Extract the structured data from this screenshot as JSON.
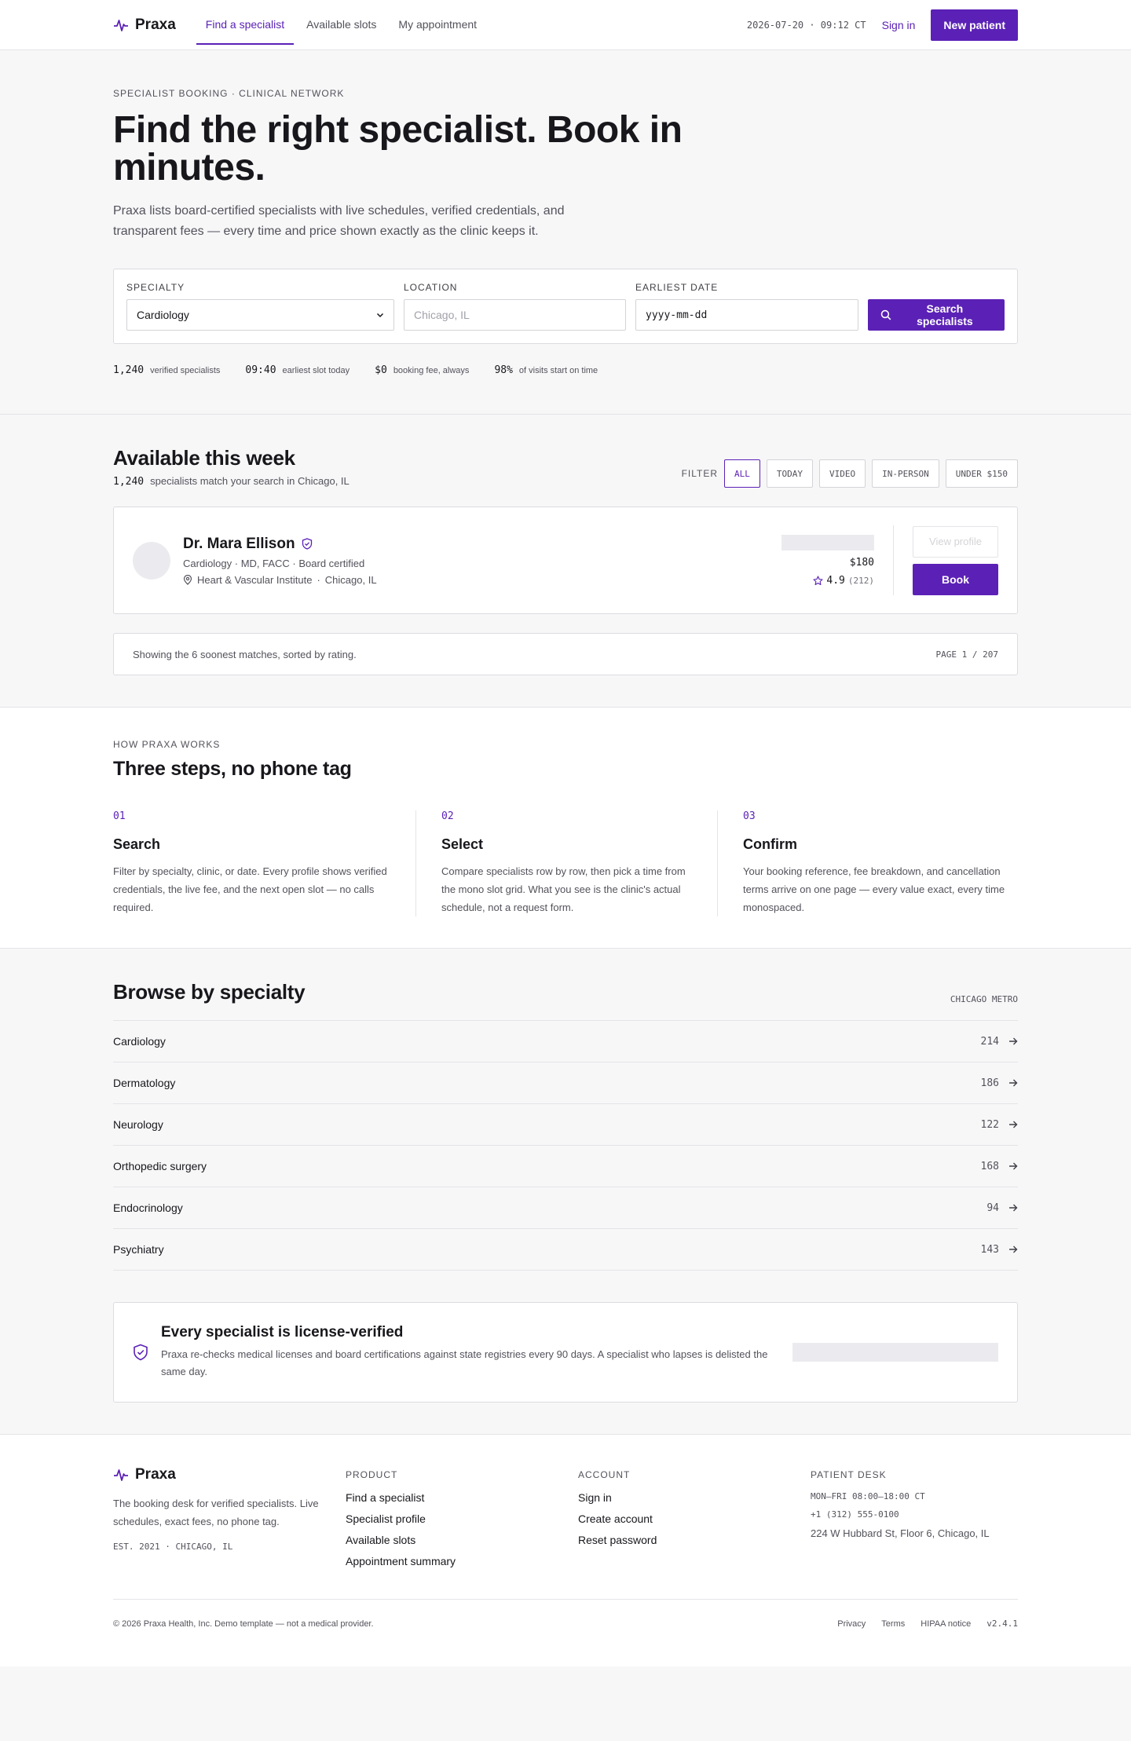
{
  "header": {
    "brand": "Praxa",
    "nav": [
      "Find a specialist",
      "Available slots",
      "My appointment"
    ],
    "timestamp": "2026-07-20 · 09:12 CT",
    "signin": "Sign in",
    "cta": "New patient"
  },
  "hero": {
    "eyebrow": "SPECIALIST BOOKING · CLINICAL NETWORK",
    "title": "Find the right specialist. Book in minutes.",
    "lede": "Praxa lists board-certified specialists with live schedules, verified credentials, and transparent fees — every time and price shown exactly as the clinic keeps it.",
    "search": {
      "specialty_label": "SPECIALTY",
      "specialty_value": "Cardiology",
      "location_label": "LOCATION",
      "location_placeholder": "Chicago, IL",
      "date_label": "EARLIEST DATE",
      "date_placeholder": "yyyy-mm-dd",
      "button": "Search specialists"
    },
    "stats": [
      {
        "value": "1,240",
        "label": "verified specialists"
      },
      {
        "value": "09:40",
        "label": "earliest slot today"
      },
      {
        "value": "$0",
        "label": "booking fee, always"
      },
      {
        "value": "98%",
        "label": "of visits start on time"
      }
    ]
  },
  "available": {
    "title": "Available this week",
    "count": "1,240",
    "count_label": "specialists match your search in Chicago, IL",
    "filter_label": "FILTER",
    "filters": [
      "ALL",
      "TODAY",
      "VIDEO",
      "IN-PERSON",
      "UNDER $150"
    ],
    "doctor": {
      "name": "Dr. Mara Ellison",
      "meta": "Cardiology · MD, FACC · Board certified",
      "clinic": "Heart & Vascular Institute",
      "city": "Chicago, IL",
      "price": "$180",
      "rating": "4.9",
      "reviews": "(212)",
      "view": "View profile",
      "book": "Book"
    },
    "pager_text": "Showing the 6 soonest matches, sorted by rating.",
    "pager_page": "PAGE 1 / 207"
  },
  "how": {
    "eyebrow": "HOW PRAXA WORKS",
    "title": "Three steps, no phone tag",
    "steps": [
      {
        "num": "01",
        "title": "Search",
        "text": "Filter by specialty, clinic, or date. Every profile shows verified credentials, the live fee, and the next open slot — no calls required."
      },
      {
        "num": "02",
        "title": "Select",
        "text": "Compare specialists row by row, then pick a time from the mono slot grid. What you see is the clinic's actual schedule, not a request form."
      },
      {
        "num": "03",
        "title": "Confirm",
        "text": "Your booking reference, fee breakdown, and cancellation terms arrive on one page — every value exact, every time monospaced."
      }
    ]
  },
  "browse": {
    "title": "Browse by specialty",
    "region": "CHICAGO METRO",
    "items": [
      {
        "name": "Cardiology",
        "count": "214"
      },
      {
        "name": "Dermatology",
        "count": "186"
      },
      {
        "name": "Neurology",
        "count": "122"
      },
      {
        "name": "Orthopedic surgery",
        "count": "168"
      },
      {
        "name": "Endocrinology",
        "count": "94"
      },
      {
        "name": "Psychiatry",
        "count": "143"
      }
    ],
    "verify_title": "Every specialist is license-verified",
    "verify_text": "Praxa re-checks medical licenses and board certifications against state registries every 90 days. A specialist who lapses is delisted the same day."
  },
  "footer": {
    "brand": "Praxa",
    "desc": "The booking desk for verified specialists. Live schedules, exact fees, no phone tag.",
    "est": "EST. 2021 · CHICAGO, IL",
    "product_head": "PRODUCT",
    "product": [
      "Find a specialist",
      "Specialist profile",
      "Available slots",
      "Appointment summary"
    ],
    "account_head": "ACCOUNT",
    "account": [
      "Sign in",
      "Create account",
      "Reset password"
    ],
    "desk_head": "PATIENT DESK",
    "hours": "MON–FRI 08:00–18:00 CT",
    "phone": "+1 (312) 555-0100",
    "address": "224 W Hubbard St, Floor 6, Chicago, IL",
    "copyright": "© 2026 Praxa Health, Inc. Demo template — not a medical provider.",
    "legal": [
      "Privacy",
      "Terms",
      "HIPAA notice"
    ],
    "version": "v2.4.1"
  },
  "colors": {
    "accent": "#5b21b6",
    "text": "#17171c",
    "muted": "#52525b",
    "border": "#e4e4e7",
    "bg": "#f7f7f8"
  }
}
